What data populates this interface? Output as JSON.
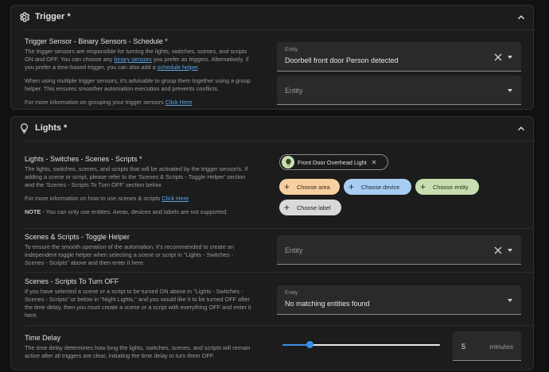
{
  "trigger_panel": {
    "title": "Trigger *",
    "sensor": {
      "label": "Trigger Sensor - Binary Sensors - Schedule *",
      "desc_line1": "The trigger sensors are responsible for turning the lights, switches, scenes, and scripts",
      "desc_line2_a": "ON and OFF. You can choose any ",
      "desc_line2_link": "binary sensors",
      "desc_line2_b": " you prefer as triggers. Alternatively, if",
      "desc_line3_a": "you prefer a time-based trigger, you can also add a ",
      "desc_line3_link": "schedule helper",
      "desc_line3_b": ".",
      "desc_para2_line1": "When using multiple trigger sensors, it's advisable to group them together using a group",
      "desc_para2_line2": "helper. This ensures smoother automation execution and prevents conflicts.",
      "desc_para3_text": "For more information on grouping your trigger sensors ",
      "desc_para3_link": "Click Here",
      "field1_label": "Entity",
      "field1_value": "Doorbell front door Person detected",
      "field2_placeholder": "Entity"
    }
  },
  "lights_panel": {
    "title": "Lights *",
    "lights_row": {
      "label": "Lights - Switches - Scenes - Scripts *",
      "desc_line1": "The lights, switches, scenes, and scripts that will be activated by the trigger sensor/s. If",
      "desc_line2": "adding a scene or script, please refer to the 'Scenes & Scripts - Toggle Helper' section",
      "desc_line3": "and the 'Scenes - Scripts To Turn OFF' section below.",
      "desc_para2_text": "For more information on how to use scenes & scripts ",
      "desc_para2_link": "Click Here",
      "note_bold": "NOTE",
      "note_text": " - You can only use entities. Areas, devices and labels are not supported.",
      "entity_chip": "Front Door Overhead Light",
      "choose_area": "Choose area",
      "choose_device": "Choose device",
      "choose_entity": "Choose entity",
      "choose_label": "Choose label"
    },
    "toggle_row": {
      "label": "Scenes & Scripts - Toggle Helper",
      "desc_line1": "To ensure the smooth operation of the automation, it's recommended to create an",
      "desc_line2": "independent toggle helper when selecting a scene or script in \"Lights - Switches -",
      "desc_line3": "Scenes - Scripts\" above and then enter it here.",
      "field_placeholder": "Entity"
    },
    "turn_off_row": {
      "label": "Scenes - Scripts To Turn OFF",
      "desc_line1": "If you have selected a scene or a script to be turned ON above in \"Lights - Switches -",
      "desc_line2": "Scenes - Scripts\" or below in \"Night Lights,\" and you would like it to be turned OFF after",
      "desc_line3": "the time delay, then you must create a scene or a script with everything OFF and enter it",
      "desc_line4": "here.",
      "field_label": "Entity",
      "field_value": "No matching entities found"
    },
    "time_delay_row": {
      "label": "Time Delay",
      "desc_line1": "The time delay determines how long the lights, switches, scenes, and scripts will remain",
      "desc_line2": "active after all triggers are clear, initiating the time delay to turn them OFF.",
      "slider_level_fraction": 0.17,
      "value": "5",
      "unit": "minutes"
    }
  },
  "colors": {
    "area_chip": "#f7cfa0",
    "device_chip": "#a7cdf2",
    "entity_chip": "#c8deb0",
    "label_chip": "#d9d9d9",
    "accent": "#3b8ee6"
  }
}
